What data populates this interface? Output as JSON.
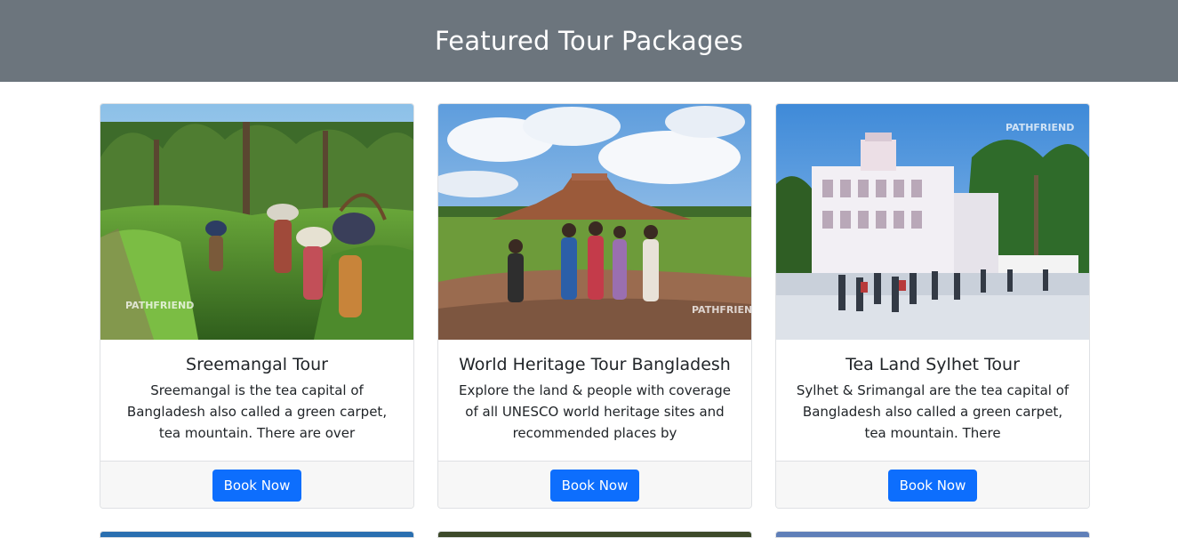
{
  "header": {
    "title": "Featured Tour Packages"
  },
  "cards": [
    {
      "title": "Sreemangal Tour",
      "description": "Sreemangal is the tea capital of Bangladesh also called a green carpet, tea mountain. There are over",
      "button_label": "Book Now",
      "image_alt": "Tea pickers carrying baskets in a tea garden",
      "watermark": "PATHFRIEND"
    },
    {
      "title": "World Heritage Tour Bangladesh",
      "description": "Explore the land & people with coverage of all UNESCO world heritage sites and recommended places by",
      "button_label": "Book Now",
      "image_alt": "Tourists standing before an ancient brick monastery ruin",
      "watermark": "PATHFRIEND"
    },
    {
      "title": "Tea Land Sylhet Tour",
      "description": "Sylhet & Srimangal are the tea capital of Bangladesh also called a green carpet, tea mountain. There",
      "button_label": "Book Now",
      "image_alt": "White shrine building with crowd in a courtyard",
      "watermark": "PATHFRIEND"
    }
  ],
  "colors": {
    "banner": "#6c757d",
    "button": "#0d6efd",
    "footer": "#f7f7f7"
  }
}
